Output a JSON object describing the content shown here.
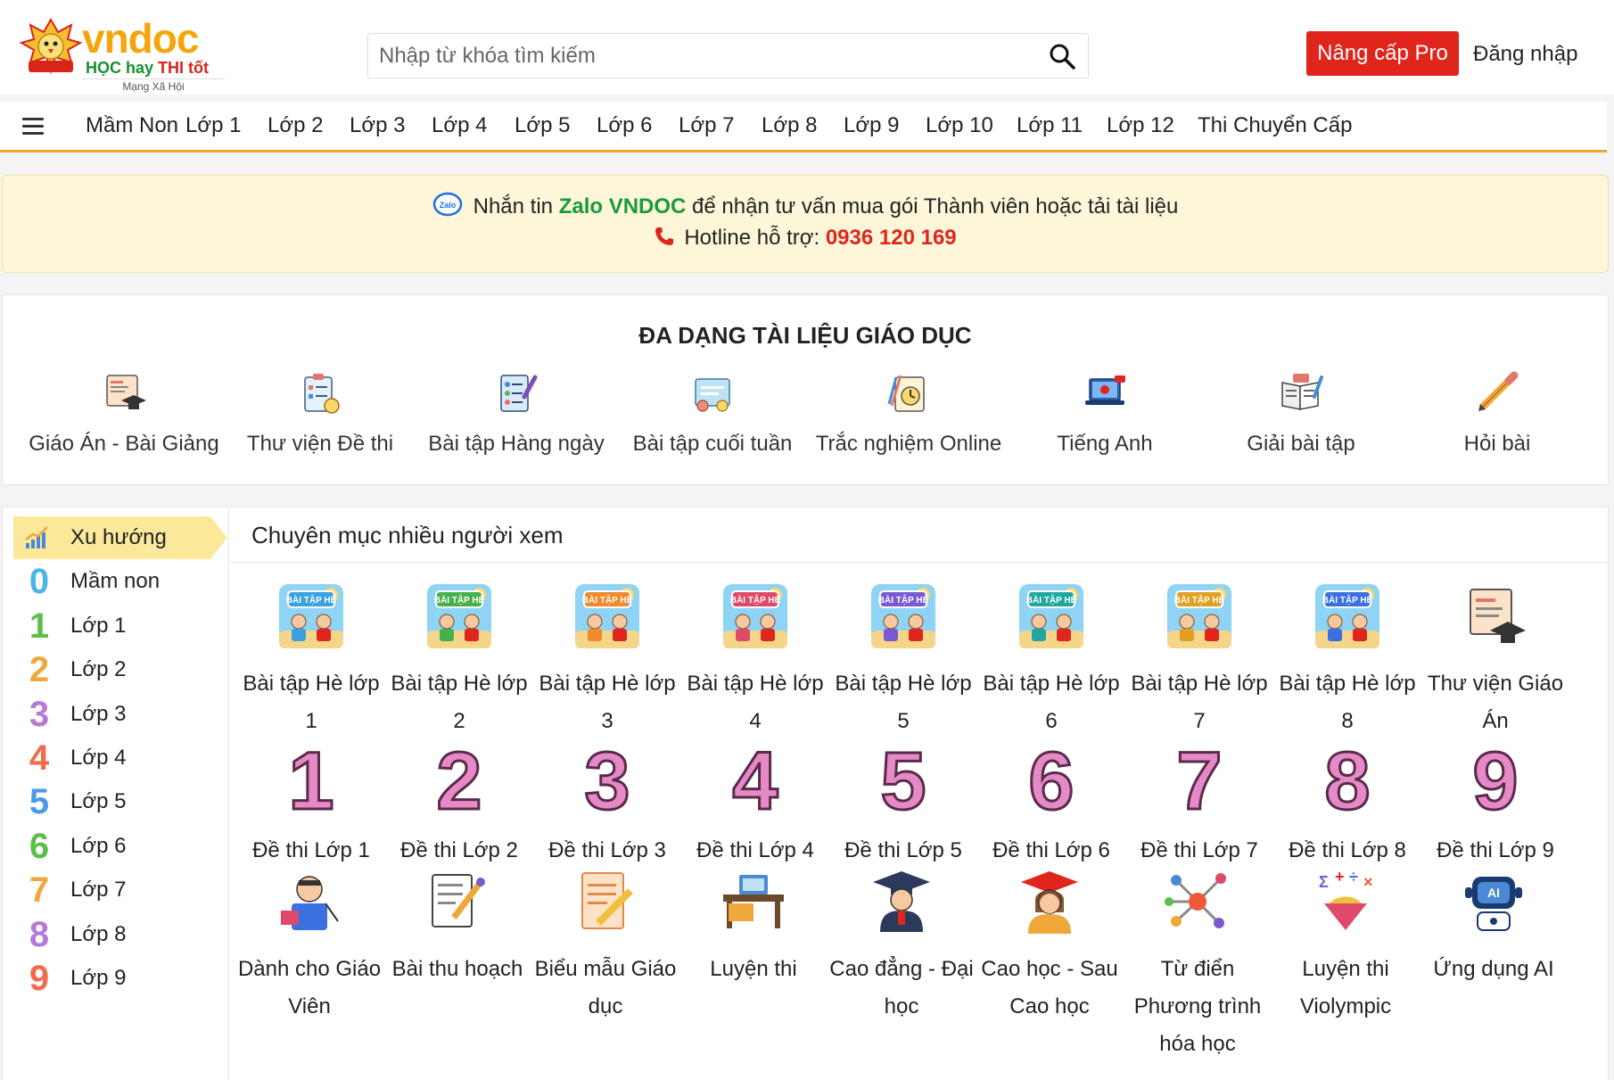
{
  "header": {
    "logo_brand": "vndoc",
    "logo_tag1": "HỌC hay",
    "logo_tag2": "THI tốt",
    "logo_sub": "Mạng Xã Hội",
    "search_placeholder": "Nhập từ khóa tìm kiếm",
    "upgrade_label": "Nâng cấp Pro",
    "login_label": "Đăng nhập"
  },
  "nav": {
    "items": [
      "Mầm Non",
      "Lớp 1",
      "Lớp 2",
      "Lớp 3",
      "Lớp 4",
      "Lớp 5",
      "Lớp 6",
      "Lớp 7",
      "Lớp 8",
      "Lớp 9",
      "Lớp 10",
      "Lớp 11",
      "Lớp 12",
      "Thi Chuyển Cấp"
    ]
  },
  "notice": {
    "text_before": "Nhắn tin ",
    "zalo": "Zalo VNDOC",
    "text_after": " để nhận tư vấn mua gói Thành viên hoặc tải tài liệu",
    "hotline_label": "Hotline hỗ trợ: ",
    "hotline_number": "0936 120 169"
  },
  "categories": {
    "title": "ĐA DẠNG TÀI LIỆU GIÁO DỤC",
    "items": [
      "Giáo Án - Bài Giảng",
      "Thư viện Đề thi",
      "Bài tập Hàng ngày",
      "Bài tập cuối tuần",
      "Trắc nghiệm Online",
      "Tiếng Anh",
      "Giải bài tập",
      "Hỏi bài"
    ]
  },
  "sidebar": {
    "items": [
      {
        "num": "",
        "label": "Xu hướng"
      },
      {
        "num": "0",
        "label": "Mầm non"
      },
      {
        "num": "1",
        "label": "Lớp 1"
      },
      {
        "num": "2",
        "label": "Lớp 2"
      },
      {
        "num": "3",
        "label": "Lớp 3"
      },
      {
        "num": "4",
        "label": "Lớp 4"
      },
      {
        "num": "5",
        "label": "Lớp 5"
      },
      {
        "num": "6",
        "label": "Lớp 6"
      },
      {
        "num": "7",
        "label": "Lớp 7"
      },
      {
        "num": "8",
        "label": "Lớp 8"
      },
      {
        "num": "9",
        "label": "Lớp 9"
      }
    ]
  },
  "main": {
    "title": "Chuyên mục nhiều người xem",
    "row1": [
      "Bài tập Hè lớp 1",
      "Bài tập Hè lớp 2",
      "Bài tập Hè lớp 3",
      "Bài tập Hè lớp 4",
      "Bài tập Hè lớp 5",
      "Bài tập Hè lớp 6",
      "Bài tập Hè lớp 7",
      "Bài tập Hè lớp 8",
      "Thư viện Giáo Án"
    ],
    "row2_nums": [
      "1",
      "2",
      "3",
      "4",
      "5",
      "6",
      "7",
      "8",
      "9"
    ],
    "row2": [
      "Đề thi Lớp 1",
      "Đề thi Lớp 2",
      "Đề thi Lớp 3",
      "Đề thi Lớp 4",
      "Đề thi Lớp 5",
      "Đề thi Lớp 6",
      "Đề thi Lớp 7",
      "Đề thi Lớp 8",
      "Đề thi Lớp 9"
    ],
    "row3": [
      "Dành cho Giáo Viên",
      "Bài thu hoạch",
      "Biểu mẫu Giáo dục",
      "Luyện thi",
      "Cao đẳng - Đại học",
      "Cao học - Sau Cao học",
      "Từ điển Phương trình hóa học",
      "Luyện thi Violympic",
      "Ứng dụng AI"
    ],
    "badge_word": "BÀI TẬP HÈ",
    "ai_badge": "AI"
  },
  "colors": {
    "accent_orange": "#f5a524",
    "pro_red": "#e0261c",
    "zalo_green": "#1a9a3a",
    "notice_bg": "#fdf6d9",
    "trend_bg": "#fbe89a"
  },
  "icons": {
    "search": "search-icon",
    "menu": "hamburger-menu-icon",
    "zalo": "zalo-icon",
    "phone": "phone-icon"
  }
}
